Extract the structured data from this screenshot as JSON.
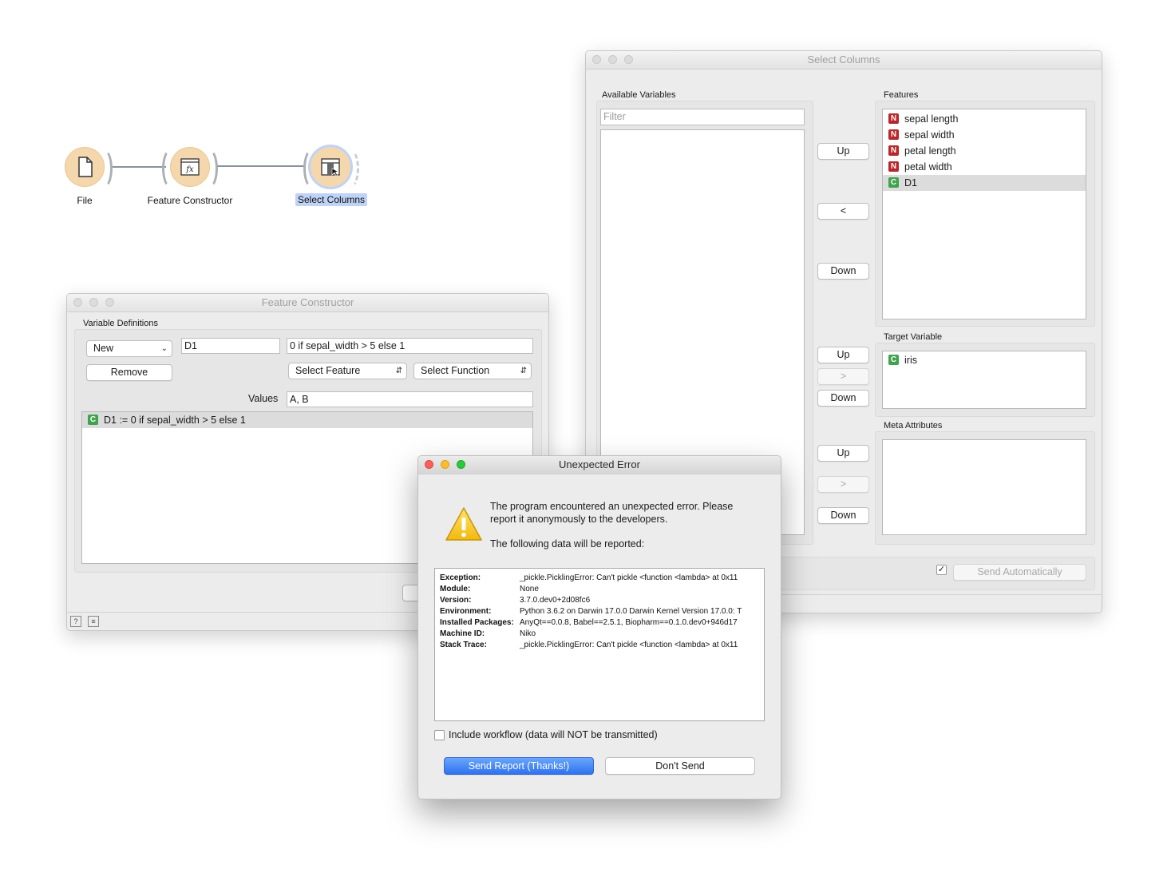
{
  "canvas": {
    "nodes": [
      {
        "label": "File",
        "icon": "document-icon"
      },
      {
        "label": "Feature Constructor",
        "icon": "formula-icon"
      },
      {
        "label": "Select Columns",
        "icon": "select-columns-icon",
        "selected": true
      }
    ]
  },
  "select_columns": {
    "title": "Select Columns",
    "available_label": "Available Variables",
    "filter_placeholder": "Filter",
    "features_label": "Features",
    "features": [
      {
        "badge": "N",
        "name": "sepal length"
      },
      {
        "badge": "N",
        "name": "sepal width"
      },
      {
        "badge": "N",
        "name": "petal length"
      },
      {
        "badge": "N",
        "name": "petal width"
      },
      {
        "badge": "C",
        "name": "D1",
        "selected": true
      }
    ],
    "target_label": "Target Variable",
    "target": [
      {
        "badge": "C",
        "name": "iris"
      }
    ],
    "meta_label": "Meta Attributes",
    "buttons": {
      "up": "Up",
      "left": "<",
      "down": "Down",
      "right": ">"
    },
    "send_auto_checked": "✓",
    "send_automatically": "Send Automatically"
  },
  "feature_constructor": {
    "title": "Feature Constructor",
    "var_defs_label": "Variable Definitions",
    "new_option": "New",
    "name_value": "D1",
    "expression_value": "0 if sepal_width > 5 else 1",
    "remove_label": "Remove",
    "select_feature": "Select Feature",
    "select_function": "Select Function",
    "values_label": "Values",
    "values_value": "A, B",
    "definitions": [
      {
        "badge": "C",
        "text": "D1 := 0 if sepal_width > 5 else 1"
      }
    ]
  },
  "error_dialog": {
    "title": "Unexpected Error",
    "message": "The program encountered an unexpected error. Please report it anonymously to the developers.",
    "message_line1": "The program encountered an unexpected error. Please",
    "message_line2": "report it anonymously to the developers.",
    "following": "The following data will be reported:",
    "report": [
      {
        "key": "Exception:",
        "value": "_pickle.PicklingError: Can't pickle <function <lambda> at 0x11"
      },
      {
        "key": "Module:",
        "value": "None"
      },
      {
        "key": "Version:",
        "value": "3.7.0.dev0+2d08fc6"
      },
      {
        "key": "Environment:",
        "value": "Python 3.6.2 on Darwin 17.0.0 Darwin Kernel Version 17.0.0: T"
      },
      {
        "key": "Installed Packages:",
        "value": "AnyQt==0.0.8, Babel==2.5.1, Biopharm==0.1.0.dev0+946d17"
      },
      {
        "key": "Machine ID:",
        "value": "Niko"
      },
      {
        "key": "Stack Trace:",
        "value": "_pickle.PicklingError: Can't pickle <function <lambda> at 0x11"
      }
    ],
    "include_workflow": "Include workflow (data will NOT be transmitted)",
    "send_report": "Send Report (Thanks!)",
    "dont_send": "Don't Send"
  },
  "colors": {
    "node_fill": "#f4d7ad",
    "selection_blue": "#bfd3f7",
    "numeric_badge": "#b8272a",
    "categorical_badge": "#3fa34d",
    "primary_button": "#2f72ef"
  }
}
